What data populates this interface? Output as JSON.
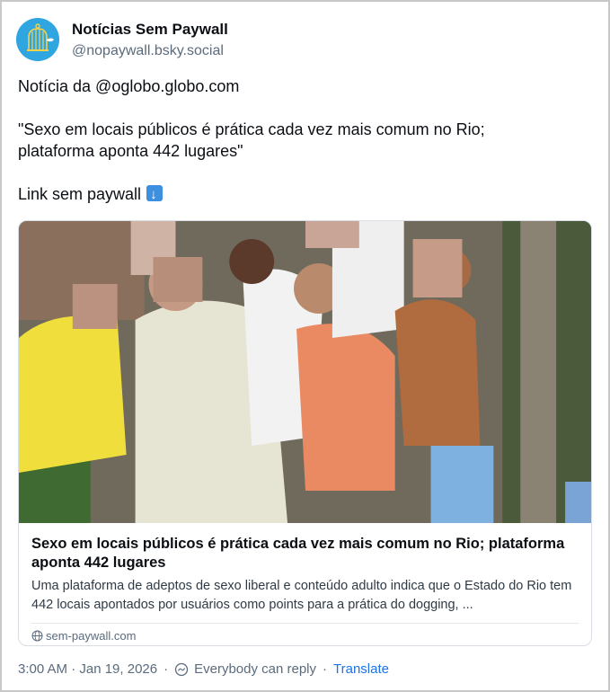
{
  "post": {
    "display_name": "Notícias Sem Paywall",
    "handle": "@nopaywall.bsky.social",
    "text_line1": "Notícia da @oglobo.globo.com",
    "text_quote_line1": "\"Sexo em locais públicos é prática cada vez mais comum no Rio;",
    "text_quote_line2": "plataforma aponta 442 lugares\"",
    "text_link_label": "Link sem paywall",
    "link_emoji": "arrow-down-emoji"
  },
  "card": {
    "title": "Sexo em locais públicos é prática cada vez mais comum no Rio; plataforma aponta 442 lugares",
    "description": "Uma plataforma de adeptos de sexo liberal e conteúdo adulto indica que o Estado do Rio tem 442 locais apontados por usuários como points para a prática do dogging, ...",
    "domain": "sem-paywall.com",
    "image": "blurred-crowd-photo"
  },
  "footer": {
    "timestamp": "3:00 AM · Jan 19, 2026",
    "reply_setting": "Everybody can reply",
    "separator": "·",
    "translate_label": "Translate"
  },
  "colors": {
    "accent": "#1a73e8",
    "avatar_bg": "#2fa6e0",
    "muted_text": "#5b6b7d"
  }
}
